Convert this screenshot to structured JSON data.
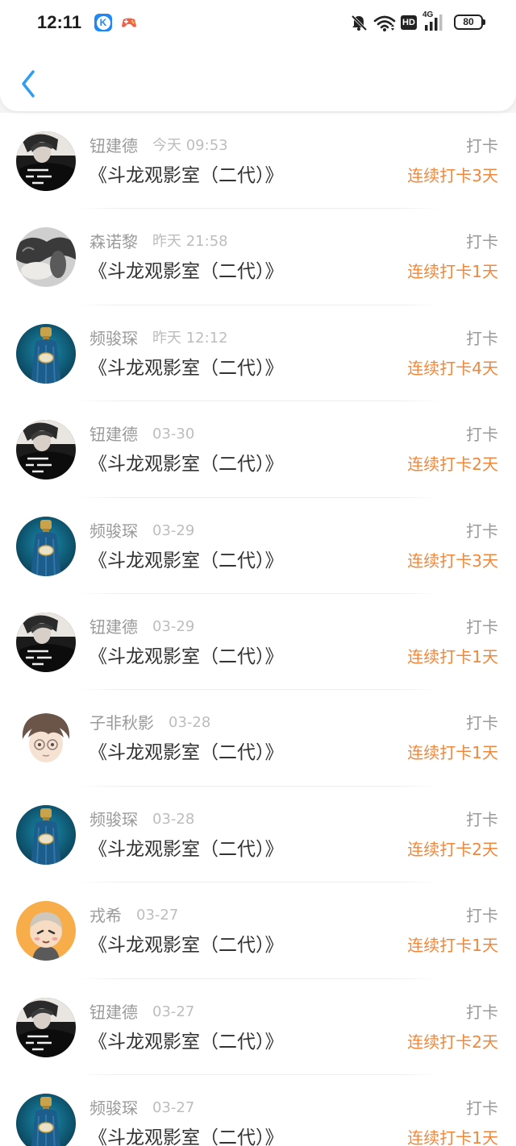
{
  "status_bar": {
    "time": "12:11",
    "app_icon_letter": "K",
    "hd": "HD",
    "network": "4G",
    "battery": "80",
    "icons": {
      "app": "k-app-icon",
      "game": "game-controller-icon",
      "notifications": "bell-off-icon",
      "wifi": "wifi-icon",
      "signal": "signal-bars-icon",
      "battery": "battery-icon"
    }
  },
  "header": {
    "back_icon": "chevron-left-icon"
  },
  "colors": {
    "accent": "#2f9df4",
    "streak": "#f0873a",
    "name": "#9a9a9a",
    "time": "#bdbdbd",
    "title": "#333333"
  },
  "list": {
    "rows": [
      {
        "name": "钮建德",
        "time": "今天 09:53",
        "title": "《斗龙观影室（二代）》",
        "action": "打卡",
        "streak": "连续打卡3天",
        "avatar": "dark-portrait"
      },
      {
        "name": "森诺黎",
        "time": "昨天 21:58",
        "title": "《斗龙观影室（二代）》",
        "action": "打卡",
        "streak": "连续打卡1天",
        "avatar": "gray-scene"
      },
      {
        "name": "频骏琛",
        "time": "昨天 12:12",
        "title": "《斗龙观影室（二代）》",
        "action": "打卡",
        "streak": "连续打卡4天",
        "avatar": "teal-bottle"
      },
      {
        "name": "钮建德",
        "time": "03-30",
        "title": "《斗龙观影室（二代）》",
        "action": "打卡",
        "streak": "连续打卡2天",
        "avatar": "dark-portrait"
      },
      {
        "name": "频骏琛",
        "time": "03-29",
        "title": "《斗龙观影室（二代）》",
        "action": "打卡",
        "streak": "连续打卡3天",
        "avatar": "teal-bottle"
      },
      {
        "name": "钮建德",
        "time": "03-29",
        "title": "《斗龙观影室（二代）》",
        "action": "打卡",
        "streak": "连续打卡1天",
        "avatar": "dark-portrait"
      },
      {
        "name": "子非秋影",
        "time": "03-28",
        "title": "《斗龙观影室（二代）》",
        "action": "打卡",
        "streak": "连续打卡1天",
        "avatar": "anime-boy"
      },
      {
        "name": "频骏琛",
        "time": "03-28",
        "title": "《斗龙观影室（二代）》",
        "action": "打卡",
        "streak": "连续打卡2天",
        "avatar": "teal-bottle"
      },
      {
        "name": "戎希",
        "time": "03-27",
        "title": "《斗龙观影室（二代）》",
        "action": "打卡",
        "streak": "连续打卡1天",
        "avatar": "cartoon-orange"
      },
      {
        "name": "钮建德",
        "time": "03-27",
        "title": "《斗龙观影室（二代）》",
        "action": "打卡",
        "streak": "连续打卡2天",
        "avatar": "dark-portrait"
      },
      {
        "name": "频骏琛",
        "time": "03-27",
        "title": "《斗龙观影室（二代）》",
        "action": "打卡",
        "streak": "连续打卡1天",
        "avatar": "teal-bottle"
      }
    ]
  }
}
